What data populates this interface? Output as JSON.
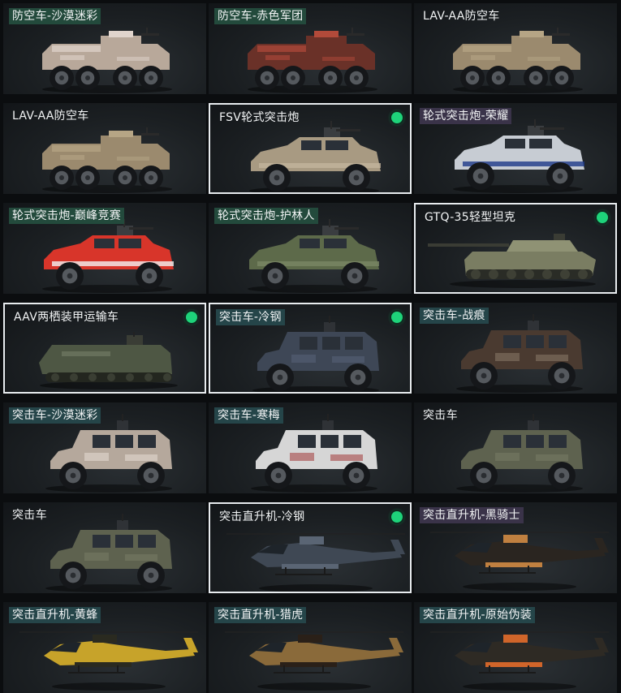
{
  "vehicles": [
    {
      "name": "防空车-沙漠迷彩",
      "kind": "apc8",
      "tag": "green",
      "selected": false,
      "active": false,
      "body_color": "#b8a89a",
      "accent_color": "#e0d4cc"
    },
    {
      "name": "防空车-赤色军团",
      "kind": "apc8",
      "tag": "green",
      "selected": false,
      "active": false,
      "body_color": "#6a3128",
      "accent_color": "#b24a3a"
    },
    {
      "name": "LAV-AA防空车",
      "kind": "apc8",
      "tag": "plain",
      "selected": false,
      "active": false,
      "body_color": "#9b8a6e",
      "accent_color": "#b6a585"
    },
    {
      "name": "LAV-AA防空车",
      "kind": "apc8",
      "tag": "plain",
      "selected": false,
      "active": false,
      "body_color": "#9b8a6e",
      "accent_color": "#b6a585"
    },
    {
      "name": "FSV轮式突击炮",
      "kind": "suv",
      "tag": "plain",
      "selected": true,
      "active": true,
      "body_color": "#a89a82",
      "accent_color": "#c2b49c"
    },
    {
      "name": "轮式突击炮-荣耀",
      "kind": "suv",
      "tag": "purple",
      "selected": false,
      "active": false,
      "body_color": "#c7ccd3",
      "accent_color": "#1e3a8a"
    },
    {
      "name": "轮式突击炮-巅峰竞赛",
      "kind": "suv",
      "tag": "green",
      "selected": false,
      "active": false,
      "body_color": "#d8352a",
      "accent_color": "#f2f2f2"
    },
    {
      "name": "轮式突击炮-护林人",
      "kind": "suv",
      "tag": "green",
      "selected": false,
      "active": false,
      "body_color": "#5d6a4a",
      "accent_color": "#7a8764"
    },
    {
      "name": "GTQ-35轻型坦克",
      "kind": "tank",
      "tag": "plain",
      "selected": true,
      "active": true,
      "body_color": "#7a7d62",
      "accent_color": "#8f9274"
    },
    {
      "name": "AAV两栖装甲运输车",
      "kind": "amphib",
      "tag": "plain",
      "selected": true,
      "active": true,
      "body_color": "#4e5744",
      "accent_color": "#666f5a"
    },
    {
      "name": "突击车-冷钢",
      "kind": "mrap",
      "tag": "teal",
      "selected": true,
      "active": true,
      "body_color": "#3e4756",
      "accent_color": "#58637a"
    },
    {
      "name": "突击车-战痕",
      "kind": "mrap",
      "tag": "teal",
      "selected": false,
      "active": false,
      "body_color": "#4a3a30",
      "accent_color": "#8a7a6a"
    },
    {
      "name": "突击车-沙漠迷彩",
      "kind": "mrap",
      "tag": "teal",
      "selected": false,
      "active": false,
      "body_color": "#b5a89c",
      "accent_color": "#e5ddd6"
    },
    {
      "name": "突击车-寒梅",
      "kind": "mrap",
      "tag": "teal",
      "selected": false,
      "active": false,
      "body_color": "#d6d6d6",
      "accent_color": "#a33a3a"
    },
    {
      "name": "突击车",
      "kind": "mrap",
      "tag": "plain",
      "selected": false,
      "active": false,
      "body_color": "#5e624f",
      "accent_color": "#787c66"
    },
    {
      "name": "突击车",
      "kind": "mrap",
      "tag": "plain",
      "selected": false,
      "active": false,
      "body_color": "#5e624f",
      "accent_color": "#787c66"
    },
    {
      "name": "突击直升机-冷钢",
      "kind": "heli",
      "tag": "plain",
      "selected": true,
      "active": true,
      "body_color": "#3f4854",
      "accent_color": "#5a6574"
    },
    {
      "name": "突击直升机-黑骑士",
      "kind": "heli",
      "tag": "purple",
      "selected": false,
      "active": false,
      "body_color": "#2a2520",
      "accent_color": "#c08040"
    },
    {
      "name": "突击直升机-黄蜂",
      "kind": "heli",
      "tag": "teal",
      "selected": false,
      "active": false,
      "body_color": "#c7a32a",
      "accent_color": "#2a2a20"
    },
    {
      "name": "突击直升机-猎虎",
      "kind": "heli",
      "tag": "teal",
      "selected": false,
      "active": false,
      "body_color": "#8a6a3a",
      "accent_color": "#2a2018"
    },
    {
      "name": "突击直升机-原始伪装",
      "kind": "heli",
      "tag": "teal",
      "selected": false,
      "active": false,
      "body_color": "#2e2a24",
      "accent_color": "#d0652a"
    }
  ]
}
